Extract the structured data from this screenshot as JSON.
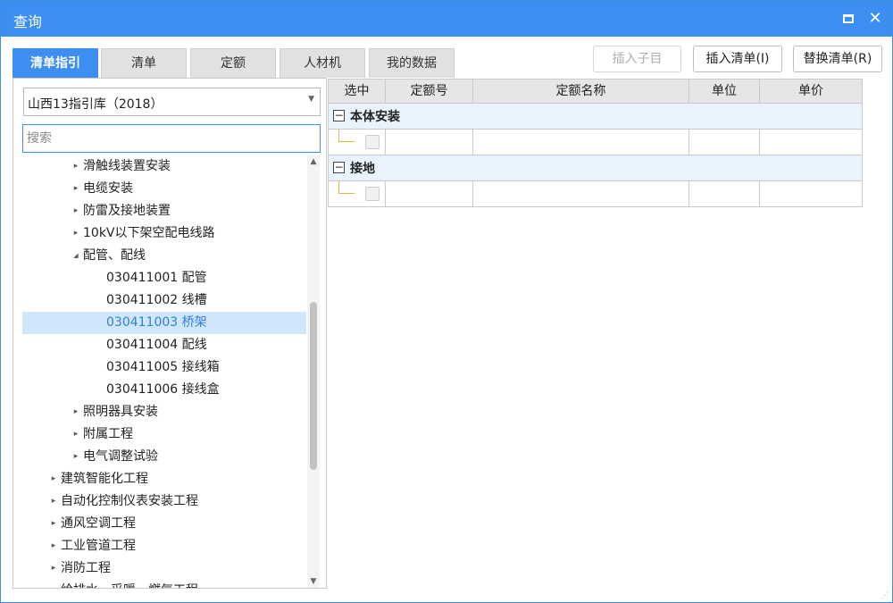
{
  "window": {
    "title": "查询",
    "maximize_icon": "maximize-icon",
    "close_icon": "close-icon",
    "close_glyph": "✕"
  },
  "tabs": [
    {
      "label": "清单指引",
      "active": true
    },
    {
      "label": "清单",
      "active": false
    },
    {
      "label": "定额",
      "active": false
    },
    {
      "label": "人材机",
      "active": false
    },
    {
      "label": "我的数据",
      "active": false
    }
  ],
  "toolbar": {
    "insert_child_label": "插入子目",
    "insert_list_label": "插入清单(I)",
    "replace_list_label": "替换清单(R)"
  },
  "library_select": {
    "value": "山西13指引库（2018）"
  },
  "search": {
    "placeholder": "搜索",
    "value": ""
  },
  "tree": [
    {
      "label": "滑触线装置安装",
      "expander": "▸"
    },
    {
      "label": "电缆安装",
      "expander": "▸"
    },
    {
      "label": "防雷及接地装置",
      "expander": "▸"
    },
    {
      "label": "10kV以下架空配电线路",
      "expander": "▸"
    },
    {
      "label": "配管、配线",
      "expander": "◢"
    },
    {
      "label": "030411001  配管",
      "expander": ""
    },
    {
      "label": "030411002  线槽",
      "expander": ""
    },
    {
      "label": "030411003  桥架",
      "expander": "",
      "selected": true
    },
    {
      "label": "030411004  配线",
      "expander": ""
    },
    {
      "label": "030411005  接线箱",
      "expander": ""
    },
    {
      "label": "030411006  接线盒",
      "expander": ""
    },
    {
      "label": "照明器具安装",
      "expander": "▸"
    },
    {
      "label": "附属工程",
      "expander": "▸"
    },
    {
      "label": "电气调整试验",
      "expander": "▸"
    },
    {
      "label": "建筑智能化工程",
      "expander": "▸"
    },
    {
      "label": "自动化控制仪表安装工程",
      "expander": "▸"
    },
    {
      "label": "通风空调工程",
      "expander": "▸"
    },
    {
      "label": "工业管道工程",
      "expander": "▸"
    },
    {
      "label": "消防工程",
      "expander": "▸"
    },
    {
      "label": "给排水、采暖、燃气工程",
      "expander": "▸"
    }
  ],
  "grid": {
    "columns": [
      "选中",
      "定额号",
      "定额名称",
      "单位",
      "单价"
    ],
    "groups": [
      {
        "title": "本体安装",
        "toggle": "−"
      },
      {
        "title": "接地",
        "toggle": "−"
      }
    ]
  }
}
